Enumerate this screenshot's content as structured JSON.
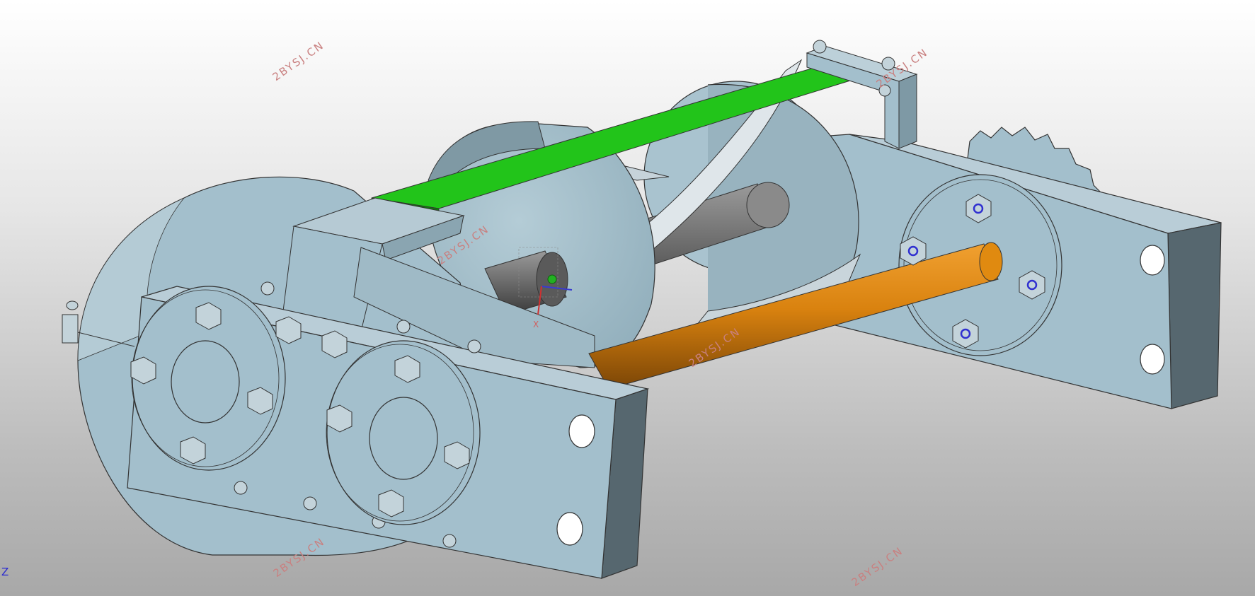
{
  "viewport": {
    "background_top": "#ffffff",
    "background_bottom": "#a8a8a8"
  },
  "watermarks": [
    "2BYSJ.CN",
    "2BYSJ.CN",
    "2BYSJ.CN",
    "2BYSJ.CN",
    "2BYSJ.CN",
    "2BYSJ.CN"
  ],
  "axis_indicator": {
    "label": "Z",
    "color": "#2a2ad0"
  },
  "triad": {
    "x_label": "X",
    "x_color": "#d06060"
  },
  "model": {
    "body_color": "#a3bfcc",
    "shaft_color": "#7a7a7a",
    "rod_color": "#d9820f",
    "strap_color": "#22c41a",
    "bolt_ring_color": "#3030d0"
  }
}
